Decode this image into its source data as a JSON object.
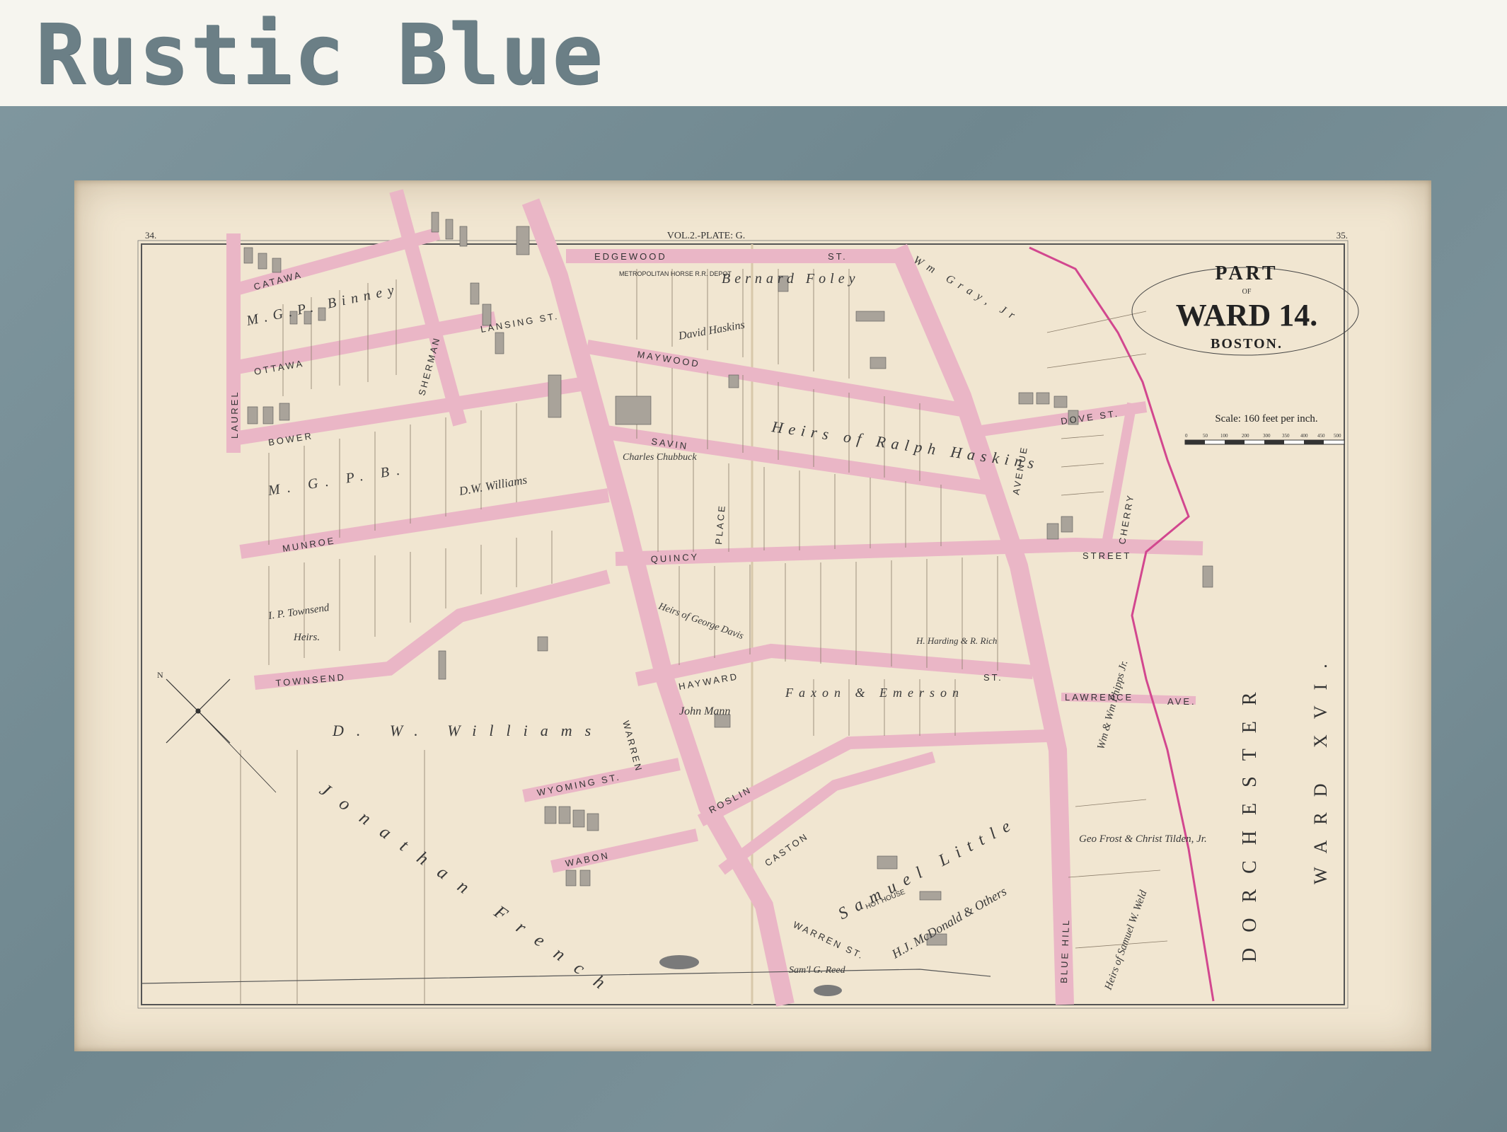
{
  "frame": {
    "title": "Rustic Blue",
    "frame_color": "#71888f"
  },
  "map": {
    "plate": "VOL.2.-PLATE: G.",
    "page_left": "34.",
    "page_right": "35.",
    "title": {
      "line1": "PART",
      "line2": "OF",
      "line3": "WARD 14.",
      "line4": "BOSTON."
    },
    "scale": {
      "label": "Scale: 160 feet per inch.",
      "ticks": [
        "0",
        "50",
        "100",
        "200",
        "300",
        "350",
        "400",
        "450",
        "500"
      ]
    },
    "streets": {
      "edgewood": "EDGEWOOD",
      "edgewood_st": "ST.",
      "maywood": "MAYWOOD",
      "savin": "SAVIN",
      "quincy": "QUINCY",
      "hayward": "HAYWARD",
      "townsend": "TOWNSEND",
      "st": "ST.",
      "bower": "BOWER",
      "munroe": "MUNROE",
      "catawa": "CATAWA",
      "ottawa": "OTTAWA",
      "laurel": "LAUREL",
      "sherman": "SHERMAN",
      "lansing": "LANSING ST.",
      "warren": "WARREN",
      "warren_st": "WARREN ST.",
      "street": "STREET",
      "avenue": "AVENUE",
      "blue_hill": "BLUE HILL",
      "dove": "DOVE ST.",
      "cherry": "CHERRY",
      "lawrence": "LAWRENCE",
      "ave": "AVE.",
      "wyoming": "WYOMING ST.",
      "wabon": "WABON",
      "roslin": "ROSLIN",
      "caston": "CASTON",
      "place": "PLACE"
    },
    "owners": {
      "bernard_foley": "Bernard Foley",
      "heirs_ralph_haskins": "Heirs of Ralph Haskins",
      "david_haskins": "David Haskins",
      "mgp_binney": "M.G.P. Binney",
      "dw_williams": "D.W. Williams",
      "dw_williams_2": "D. W. Williams",
      "mgp_b": "M. G. P. B.",
      "ip_townsend": "I. P. Townsend",
      "heirs": "Heirs.",
      "jonathan_french": "Jonathan French",
      "john_mann": "John Mann",
      "faxon_emerson": "Faxon & Emerson",
      "samuel_little": "Samuel Little",
      "hj_mcdonald": "H.J. McDonald & Others",
      "samuel_weld": "Heirs of Samuel W. Weld",
      "frost_tilden": "Geo Frost & Christ Tilden, Jr.",
      "wm_gray": "Wm Gray, Jr",
      "wm_phipps": "Wm & Wm Phipps Jr.",
      "charles_chubbuck": "Charles Chubbuck",
      "heirs_george_davis": "Heirs of George Davis",
      "metropolitan": "METROPOLITAN HORSE R.R. DEPOT",
      "hot_house": "HOT HOUSE",
      "harding_rich": "H. Harding & R. Rich",
      "sam_reed": "Sam'l G. Reed",
      "dorchester": "DORCHESTER",
      "ward_xvi": "WARD XVI."
    }
  }
}
